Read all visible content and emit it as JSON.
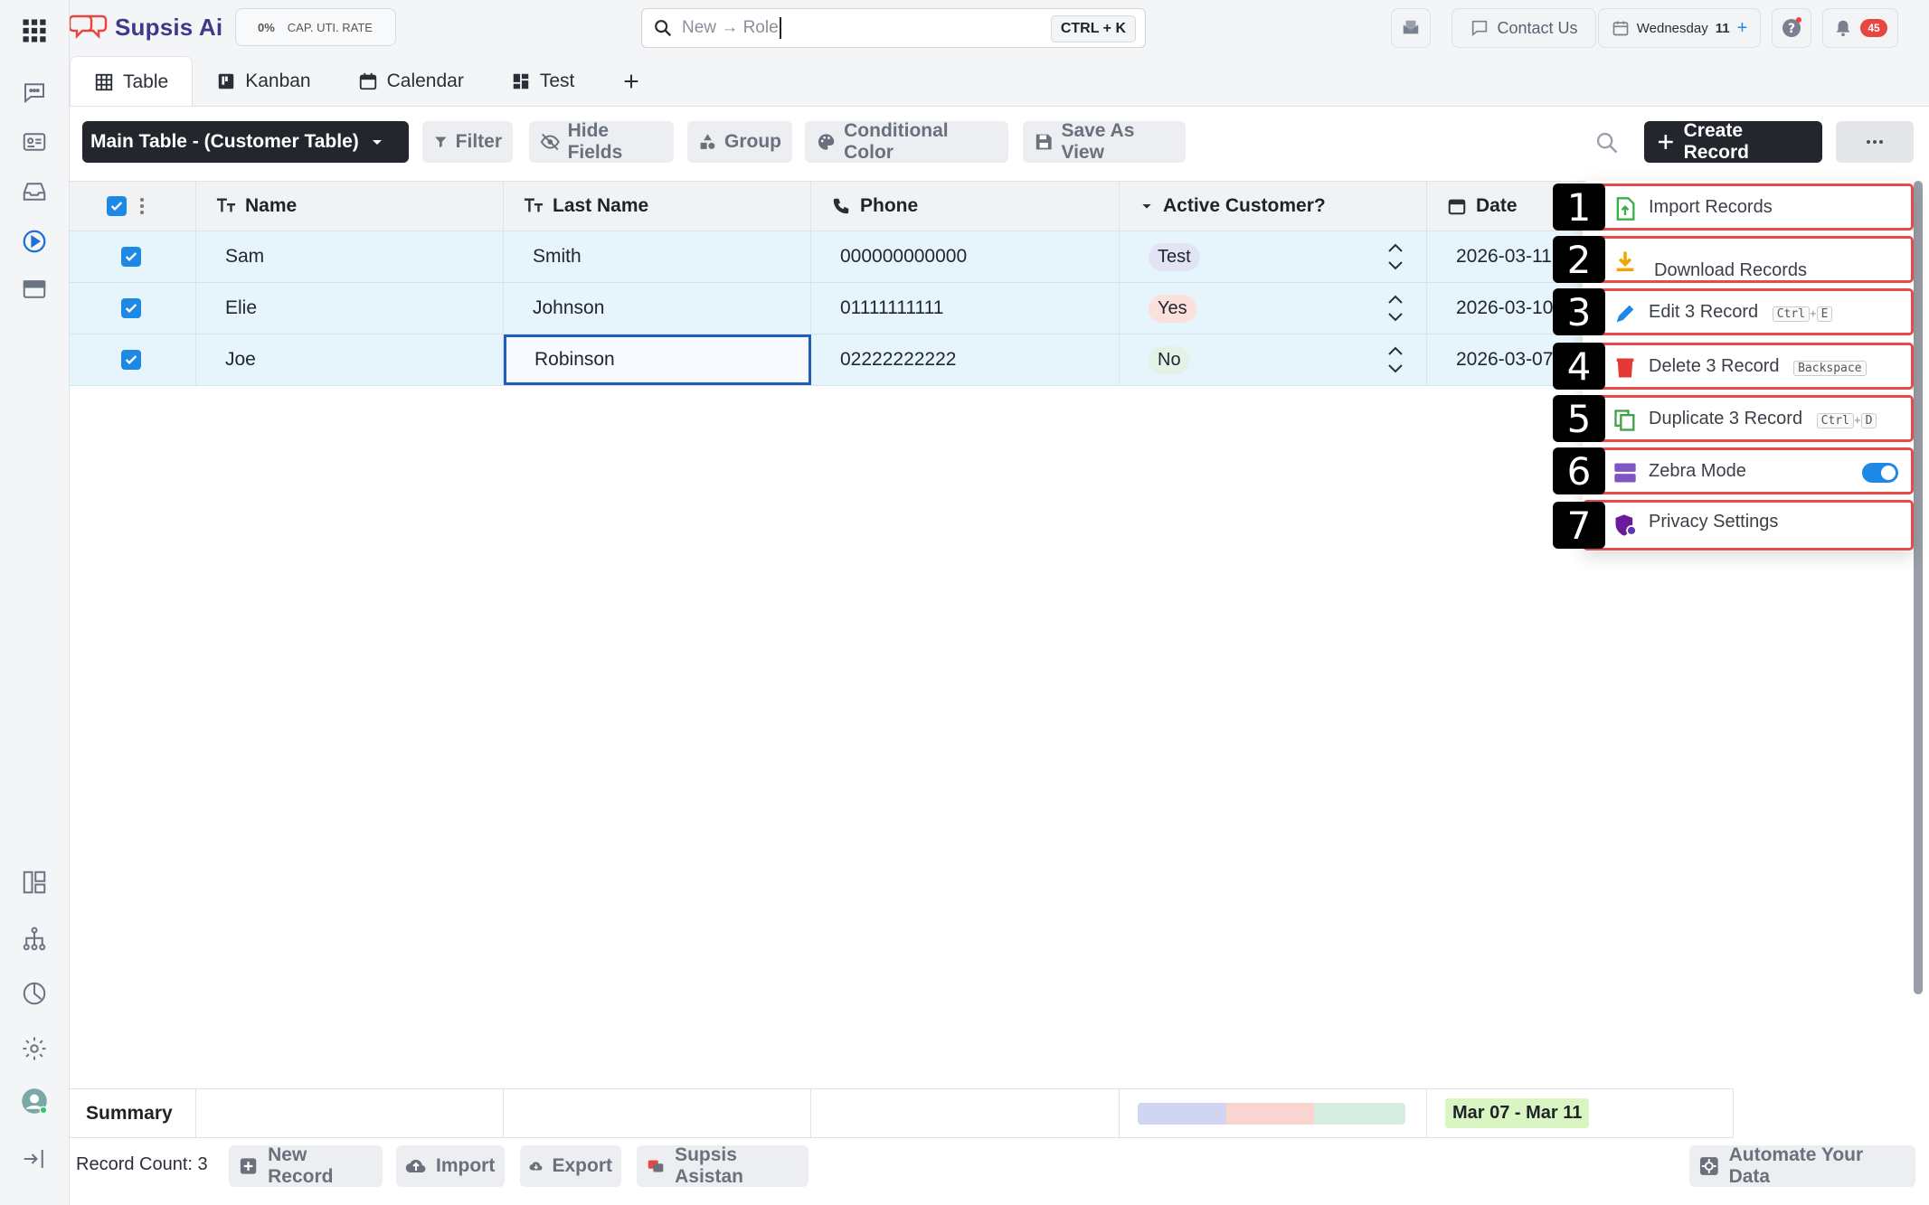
{
  "brand": {
    "name": "Supsis Ai",
    "color": "#e8463f"
  },
  "cap_badge": {
    "value": "0%",
    "label": "CAP. UTI. RATE"
  },
  "search": {
    "placeholder": "New → Role",
    "shortcut": "CTRL + K"
  },
  "topbar": {
    "contact_label": "Contact Us",
    "date_label": "Wednesday",
    "date_day": "11",
    "date_plus": "+",
    "notification_count": "45"
  },
  "tabs": [
    {
      "label": "Table",
      "icon": "table-icon",
      "active": true
    },
    {
      "label": "Kanban",
      "icon": "kanban-icon"
    },
    {
      "label": "Calendar",
      "icon": "calendar-icon"
    },
    {
      "label": "Test",
      "icon": "dashboard-icon"
    }
  ],
  "toolbar": {
    "table_select": "Main Table - (Customer Table)",
    "filter": "Filter",
    "hide_fields": "Hide Fields",
    "group": "Group",
    "conditional_color": "Conditional Color",
    "save_as_view": "Save As View",
    "create_record": "Create Record"
  },
  "columns": [
    {
      "label": "Name",
      "icon": "text-type-icon"
    },
    {
      "label": "Last Name",
      "icon": "text-type-icon"
    },
    {
      "label": "Phone",
      "icon": "phone-icon"
    },
    {
      "label": "Active Customer?",
      "icon": "dropdown-type-icon"
    },
    {
      "label": "Date",
      "icon": "calendar-icon"
    }
  ],
  "rows": [
    {
      "name": "Sam",
      "last_name": "Smith",
      "phone": "000000000000",
      "active": "Test",
      "active_color": "#e2e4f6",
      "date": "2026-03-11"
    },
    {
      "name": "Elie",
      "last_name": "Johnson",
      "phone": "01111111111",
      "active": "Yes",
      "active_color": "#fbe1dc",
      "date": "2026-03-10"
    },
    {
      "name": "Joe",
      "last_name": "Robinson",
      "phone": "02222222222",
      "active": "No",
      "active_color": "#e2f2e6",
      "date": "2026-03-07"
    }
  ],
  "summary": {
    "label": "Summary",
    "date_range": "Mar 07 - Mar 11",
    "bar_segments": [
      {
        "color": "#d2d5f2",
        "fraction": 0.33
      },
      {
        "color": "#f8d6cf",
        "fraction": 0.33
      },
      {
        "color": "#d6ede0",
        "fraction": 0.34
      }
    ]
  },
  "footer": {
    "record_count": "Record Count: 3",
    "new_record": "New Record",
    "import": "Import",
    "export": "Export",
    "assistant": "Supsis Asistan",
    "automate": "Automate Your Data"
  },
  "menu": {
    "items": [
      {
        "num": "1",
        "label": "Import Records",
        "icon": "import-file-icon",
        "color": "#3cb043"
      },
      {
        "num": "2",
        "label": "Download Records",
        "icon": "download-icon",
        "color": "#f0a500"
      },
      {
        "num": "3",
        "label": "Edit 3 Record",
        "icon": "pencil-icon",
        "color": "#1e88e5",
        "keys": [
          "Ctrl",
          "E"
        ]
      },
      {
        "num": "4",
        "label": "Delete 3 Record",
        "icon": "trash-icon",
        "color": "#e53935",
        "keys": [
          "Backspace"
        ]
      },
      {
        "num": "5",
        "label": "Duplicate 3 Record",
        "icon": "duplicate-icon",
        "color": "#43a047",
        "keys": [
          "Ctrl",
          "D"
        ]
      },
      {
        "num": "6",
        "label": "Zebra Mode",
        "icon": "zebra-icon",
        "color": "#7e57c2",
        "toggle_on": true
      },
      {
        "num": "7",
        "label": "Privacy Settings",
        "icon": "privacy-shield-icon",
        "color": "#6a1b9a"
      }
    ]
  }
}
